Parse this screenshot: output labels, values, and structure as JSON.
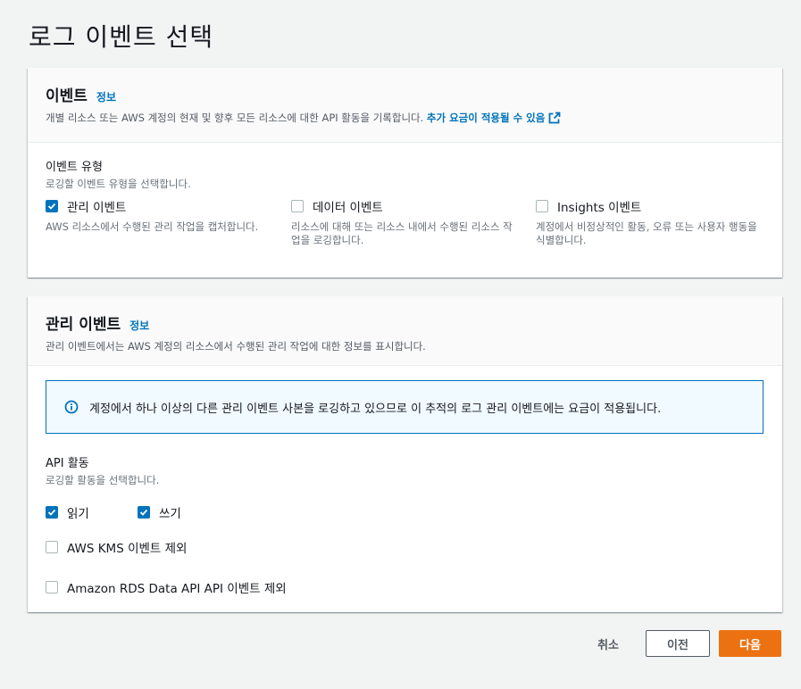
{
  "page": {
    "title": "로그 이벤트 선택"
  },
  "events_panel": {
    "title": "이벤트",
    "info": "정보",
    "description": "개별 리소스 또는 AWS 계정의 현재 및 향후 모든 리소스에 대한 API 활동을 기록합니다.",
    "cost_link": "추가 요금이 적용될 수 있음",
    "event_type_label": "이벤트 유형",
    "event_type_desc": "로깅할 이벤트 유형을 선택합니다.",
    "options": [
      {
        "label": "관리 이벤트",
        "desc": "AWS 리소스에서 수행된 관리 작업을 캡처합니다.",
        "checked": true
      },
      {
        "label": "데이터 이벤트",
        "desc": "리소스에 대해 또는 리소스 내에서 수행된 리소스 작업을 로깅합니다.",
        "checked": false
      },
      {
        "label": "Insights 이벤트",
        "desc": "계정에서 비정상적인 활동, 오류 또는 사용자 행동을 식별합니다.",
        "checked": false
      }
    ]
  },
  "mgmt_panel": {
    "title": "관리 이벤트",
    "info": "정보",
    "description": "관리 이벤트에서는 AWS 계정의 리소스에서 수행된 관리 작업에 대한 정보를 표시합니다.",
    "alert": "계정에서 하나 이상의 다른 관리 이벤트 사본을 로깅하고 있으므로 이 추적의 로그 관리 이벤트에는 요금이 적용됩니다.",
    "api_label": "API 활동",
    "api_desc": "로깅할 활동을 선택합니다.",
    "read": {
      "label": "읽기",
      "checked": true
    },
    "write": {
      "label": "쓰기",
      "checked": true
    },
    "exclude_kms": {
      "label": "AWS KMS 이벤트 제외",
      "checked": false
    },
    "exclude_rds": {
      "label": "Amazon RDS Data API API 이벤트 제외",
      "checked": false
    }
  },
  "footer": {
    "cancel": "취소",
    "previous": "이전",
    "next": "다음"
  },
  "colors": {
    "link": "#0073bb",
    "primary": "#ec7211",
    "background": "#f2f3f3"
  }
}
